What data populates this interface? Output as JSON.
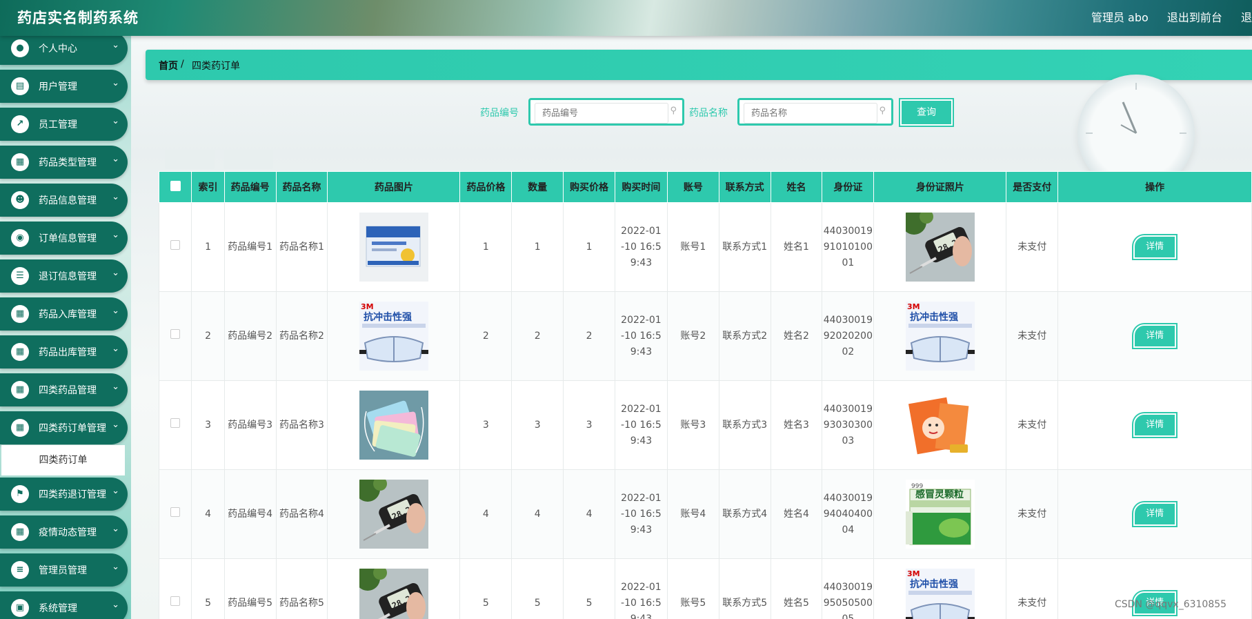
{
  "app": {
    "title": "药店实名制药系统",
    "user": "管理员 abo",
    "back_to_front": "退出到前台",
    "logout": "退"
  },
  "colors": {
    "accent": "#2ec9ad",
    "sidebar": "#0f6e5e"
  },
  "sidebar": {
    "items": [
      {
        "label": "个人中心",
        "icon": "user-icon"
      },
      {
        "label": "用户管理",
        "icon": "clipboard-icon"
      },
      {
        "label": "员工管理",
        "icon": "chart-icon"
      },
      {
        "label": "药品类型管理",
        "icon": "grid-icon"
      },
      {
        "label": "药品信息管理",
        "icon": "person-icon"
      },
      {
        "label": "订单信息管理",
        "icon": "location-icon"
      },
      {
        "label": "退订信息管理",
        "icon": "list-icon"
      },
      {
        "label": "药品入库管理",
        "icon": "grid-icon"
      },
      {
        "label": "药品出库管理",
        "icon": "grid-icon"
      },
      {
        "label": "四类药品管理",
        "icon": "grid-icon"
      },
      {
        "label": "四类药订单管理",
        "icon": "grid-icon"
      },
      {
        "label": "四类药退订管理",
        "icon": "flag-icon"
      },
      {
        "label": "疫情动态管理",
        "icon": "grid-icon"
      },
      {
        "label": "管理员管理",
        "icon": "sliders-icon"
      },
      {
        "label": "系统管理",
        "icon": "wallet-icon"
      }
    ],
    "active_sub": "四类药订单"
  },
  "breadcrumb": {
    "home": "首页",
    "separator": "/",
    "current": "四类药订单"
  },
  "search": {
    "code_label": "药品编号",
    "code_placeholder": "药品编号",
    "name_label": "药品名称",
    "name_placeholder": "药品名称",
    "query": "查询"
  },
  "table": {
    "headers": [
      "索引",
      "药品编号",
      "药品名称",
      "药品图片",
      "药品价格",
      "数量",
      "购买价格",
      "购买时间",
      "账号",
      "联系方式",
      "姓名",
      "身份证",
      "身份证照片",
      "是否支付",
      "操作"
    ],
    "rows": [
      {
        "index": "1",
        "code": "药品编号1",
        "name": "药品名称1",
        "drug_img": "medicine-box",
        "price": "1",
        "qty": "1",
        "buy_price": "1",
        "time": "2022-01-10 16:59:43",
        "account": "账号1",
        "contact": "联系方式1",
        "person": "姓名1",
        "id_no": "440300199101010001",
        "id_img": "thermometer",
        "paid": "未支付",
        "action": "详情"
      },
      {
        "index": "2",
        "code": "药品编号2",
        "name": "药品名称2",
        "drug_img": "goggles",
        "price": "2",
        "qty": "2",
        "buy_price": "2",
        "time": "2022-01-10 16:59:43",
        "account": "账号2",
        "contact": "联系方式2",
        "person": "姓名2",
        "id_no": "440300199202020002",
        "id_img": "goggles",
        "paid": "未支付",
        "action": "详情"
      },
      {
        "index": "3",
        "code": "药品编号3",
        "name": "药品名称3",
        "drug_img": "masks",
        "price": "3",
        "qty": "3",
        "buy_price": "3",
        "time": "2022-01-10 16:59:43",
        "account": "账号3",
        "contact": "联系方式3",
        "person": "姓名3",
        "id_no": "440300199303030003",
        "id_img": "kids-medicine",
        "paid": "未支付",
        "action": "详情"
      },
      {
        "index": "4",
        "code": "药品编号4",
        "name": "药品名称4",
        "drug_img": "thermometer",
        "price": "4",
        "qty": "4",
        "buy_price": "4",
        "time": "2022-01-10 16:59:43",
        "account": "账号4",
        "contact": "联系方式4",
        "person": "姓名4",
        "id_no": "440300199404040004",
        "id_img": "cold-granules",
        "paid": "未支付",
        "action": "详情"
      },
      {
        "index": "5",
        "code": "药品编号5",
        "name": "药品名称5",
        "drug_img": "thermometer",
        "price": "5",
        "qty": "5",
        "buy_price": "5",
        "time": "2022-01-10 16:59:43",
        "account": "账号5",
        "contact": "联系方式5",
        "person": "姓名5",
        "id_no": "440300199505050005",
        "id_img": "goggles",
        "paid": "未支付",
        "action": "详情"
      }
    ]
  },
  "product_text": {
    "brand": "3M",
    "goggles": "抗冲击性强",
    "cold": "感冒灵颗粒",
    "cold_brand": "999",
    "thermo": "28.2"
  },
  "watermark": "CSDN @qqvx_6310855"
}
